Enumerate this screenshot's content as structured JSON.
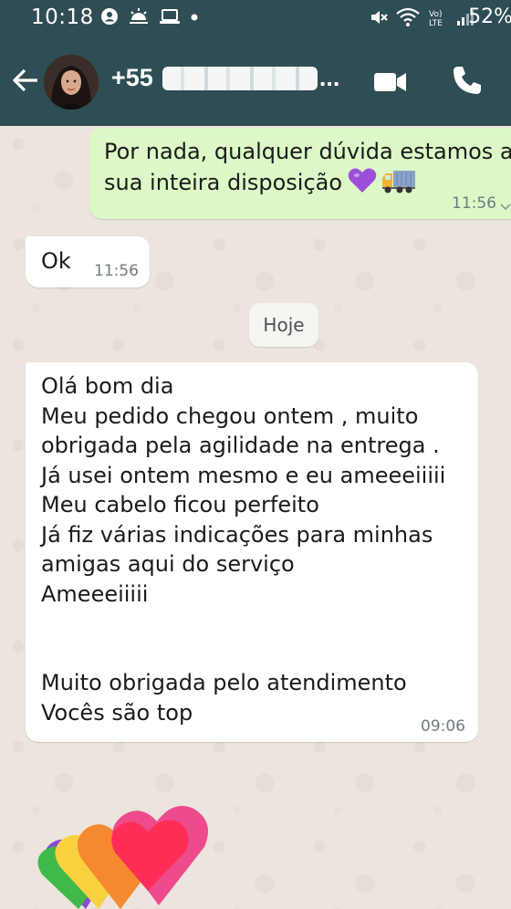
{
  "status_bar": {
    "time": "10:18",
    "battery": "52%",
    "icons_left": [
      "whatsapp-status-icon",
      "weather-icon",
      "laptop-icon",
      "dot-icon"
    ],
    "icons_right": [
      "mute-icon",
      "wifi-icon",
      "volte-icon",
      "signal-icon"
    ]
  },
  "header": {
    "contact_prefix": "+55",
    "contact_suffix": "...",
    "back_icon": "back-arrow-icon",
    "video_icon": "video-call-icon",
    "call_icon": "phone-icon"
  },
  "messages": [
    {
      "direction": "outgoing",
      "text_line1": "Por nada, qualquer dúvida estamos a",
      "text_line2": "sua inteira disposição",
      "emojis": [
        "purple-heart",
        "truck"
      ],
      "time": "11:56"
    },
    {
      "direction": "incoming",
      "text": "Ok",
      "time": "11:56"
    },
    {
      "direction": "incoming",
      "text": "Olá bom dia\nMeu pedido chegou ontem , muito\nobrigada pela agilidade na entrega .\nJá usei ontem mesmo e eu ameeeiiiii\nMeu cabelo ficou perfeito\nJá fiz várias indicações para minhas\namigas aqui do serviço\nAmeeeiiiii\n\n\nMuito obrigada pelo atendimento\nVocês são top",
      "time": "09:06"
    }
  ],
  "date_divider": "Hoje",
  "sticker": {
    "name": "rainbow-hearts-sticker",
    "colors": [
      "#40b84a",
      "#f7d23e",
      "#f5892f",
      "#ee4b8c",
      "#8a4bd6",
      "#ff2d55"
    ]
  },
  "colors": {
    "header": "#2f4d55",
    "outgoing_bubble": "#dcf8c6",
    "incoming_bubble": "#ffffff",
    "chat_background": "#ece5dd"
  }
}
